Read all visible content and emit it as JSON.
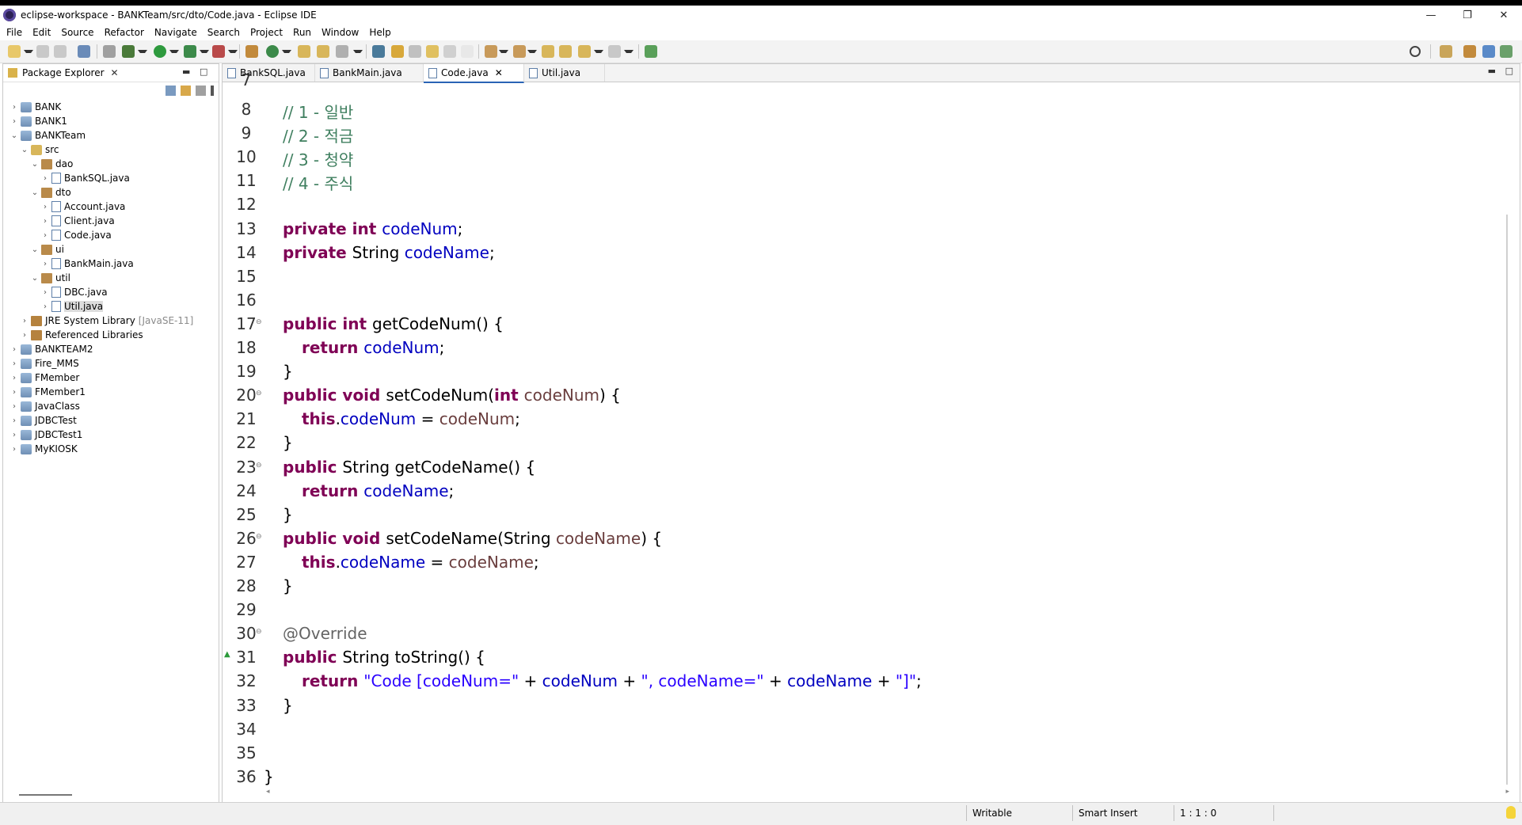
{
  "window": {
    "title": "eclipse-workspace - BANKTeam/src/dto/Code.java - Eclipse IDE",
    "minimize": "—",
    "maximize": "❐",
    "close": "✕"
  },
  "menu": [
    "File",
    "Edit",
    "Source",
    "Refactor",
    "Navigate",
    "Search",
    "Project",
    "Run",
    "Window",
    "Help"
  ],
  "explorer": {
    "title": "Package Explorer",
    "tree": [
      {
        "label": "BANK",
        "type": "proj",
        "depth": 0,
        "twisty": "›"
      },
      {
        "label": "BANK1",
        "type": "proj",
        "depth": 0,
        "twisty": "›"
      },
      {
        "label": "BANKTeam",
        "type": "proj",
        "depth": 0,
        "twisty": "⌄"
      },
      {
        "label": "src",
        "type": "src",
        "depth": 1,
        "twisty": "⌄"
      },
      {
        "label": "dao",
        "type": "pkg",
        "depth": 2,
        "twisty": "⌄"
      },
      {
        "label": "BankSQL.java",
        "type": "java",
        "depth": 3,
        "twisty": "›"
      },
      {
        "label": "dto",
        "type": "pkg",
        "depth": 2,
        "twisty": "⌄"
      },
      {
        "label": "Account.java",
        "type": "java",
        "depth": 3,
        "twisty": "›"
      },
      {
        "label": "Client.java",
        "type": "java",
        "depth": 3,
        "twisty": "›"
      },
      {
        "label": "Code.java",
        "type": "java",
        "depth": 3,
        "twisty": "›"
      },
      {
        "label": "ui",
        "type": "pkg",
        "depth": 2,
        "twisty": "⌄"
      },
      {
        "label": "BankMain.java",
        "type": "java",
        "depth": 3,
        "twisty": "›"
      },
      {
        "label": "util",
        "type": "pkg",
        "depth": 2,
        "twisty": "⌄"
      },
      {
        "label": "DBC.java",
        "type": "java",
        "depth": 3,
        "twisty": "›"
      },
      {
        "label": "Util.java",
        "type": "java",
        "depth": 3,
        "twisty": "›",
        "selected": true
      },
      {
        "label": "JRE System Library",
        "suffix": "[JavaSE-11]",
        "type": "lib",
        "depth": 1,
        "twisty": "›"
      },
      {
        "label": "Referenced Libraries",
        "type": "lib",
        "depth": 1,
        "twisty": "›"
      },
      {
        "label": "BANKTEAM2",
        "type": "proj",
        "depth": 0,
        "twisty": "›"
      },
      {
        "label": "Fire_MMS",
        "type": "proj",
        "depth": 0,
        "twisty": "›"
      },
      {
        "label": "FMember",
        "type": "proj",
        "depth": 0,
        "twisty": "›"
      },
      {
        "label": "FMember1",
        "type": "proj",
        "depth": 0,
        "twisty": "›"
      },
      {
        "label": "JavaClass",
        "type": "proj",
        "depth": 0,
        "twisty": "›"
      },
      {
        "label": "JDBCTest",
        "type": "proj",
        "depth": 0,
        "twisty": "›"
      },
      {
        "label": "JDBCTest1",
        "type": "proj",
        "depth": 0,
        "twisty": "›"
      },
      {
        "label": "MyKIOSK",
        "type": "proj",
        "depth": 0,
        "twisty": "›"
      }
    ]
  },
  "editor": {
    "tabs": [
      {
        "label": "BankSQL.java",
        "active": false
      },
      {
        "label": "BankMain.java",
        "active": false
      },
      {
        "label": "Code.java",
        "active": true
      },
      {
        "label": "Util.java",
        "active": false
      }
    ],
    "first_partial_line": "7",
    "lines": [
      {
        "n": "8",
        "tokens": [
          [
            "cm",
            "// 1 - 일반"
          ]
        ]
      },
      {
        "n": "9",
        "tokens": [
          [
            "cm",
            "// 2 - 적금"
          ]
        ]
      },
      {
        "n": "10",
        "tokens": [
          [
            "cm",
            "// 3 - 청약"
          ]
        ]
      },
      {
        "n": "11",
        "tokens": [
          [
            "cm",
            "// 4 - 주식"
          ]
        ]
      },
      {
        "n": "12",
        "tokens": []
      },
      {
        "n": "13",
        "tokens": [
          [
            "kw",
            "private int "
          ],
          [
            "fd",
            "codeNum"
          ],
          [
            "",
            "; "
          ]
        ]
      },
      {
        "n": "14",
        "tokens": [
          [
            "kw",
            "private "
          ],
          [
            "",
            "String "
          ],
          [
            "fd",
            "codeName"
          ],
          [
            "",
            ";"
          ]
        ]
      },
      {
        "n": "15",
        "tokens": []
      },
      {
        "n": "16",
        "tokens": []
      },
      {
        "n": "17",
        "fold": true,
        "tokens": [
          [
            "kw",
            "public int "
          ],
          [
            "",
            "getCodeNum() {"
          ]
        ]
      },
      {
        "n": "18",
        "indent": 1,
        "tokens": [
          [
            "kw",
            "return "
          ],
          [
            "fd",
            "codeNum"
          ],
          [
            "",
            ";"
          ]
        ]
      },
      {
        "n": "19",
        "tokens": [
          [
            "",
            "}"
          ]
        ]
      },
      {
        "n": "20",
        "fold": true,
        "tokens": [
          [
            "kw",
            "public void "
          ],
          [
            "",
            "setCodeNum("
          ],
          [
            "kw",
            "int "
          ],
          [
            "pr",
            "codeNum"
          ],
          [
            "",
            ") {"
          ]
        ]
      },
      {
        "n": "21",
        "indent": 1,
        "tokens": [
          [
            "kw",
            "this"
          ],
          [
            "",
            "."
          ],
          [
            "fd",
            "codeNum"
          ],
          [
            "",
            " = "
          ],
          [
            "pr",
            "codeNum"
          ],
          [
            "",
            ";"
          ]
        ]
      },
      {
        "n": "22",
        "tokens": [
          [
            "",
            "}"
          ]
        ]
      },
      {
        "n": "23",
        "fold": true,
        "tokens": [
          [
            "kw",
            "public "
          ],
          [
            "",
            "String getCodeName() {"
          ]
        ]
      },
      {
        "n": "24",
        "indent": 1,
        "tokens": [
          [
            "kw",
            "return "
          ],
          [
            "fd",
            "codeName"
          ],
          [
            "",
            ";"
          ]
        ]
      },
      {
        "n": "25",
        "tokens": [
          [
            "",
            "}"
          ]
        ]
      },
      {
        "n": "26",
        "fold": true,
        "tokens": [
          [
            "kw",
            "public void "
          ],
          [
            "",
            "setCodeName(String "
          ],
          [
            "pr",
            "codeName"
          ],
          [
            "",
            ") {"
          ]
        ]
      },
      {
        "n": "27",
        "indent": 1,
        "tokens": [
          [
            "kw",
            "this"
          ],
          [
            "",
            "."
          ],
          [
            "fd",
            "codeName"
          ],
          [
            "",
            " = "
          ],
          [
            "pr",
            "codeName"
          ],
          [
            "",
            ";"
          ]
        ]
      },
      {
        "n": "28",
        "tokens": [
          [
            "",
            "}"
          ]
        ]
      },
      {
        "n": "29",
        "tokens": []
      },
      {
        "n": "30",
        "fold": true,
        "tokens": [
          [
            "an",
            "@Override"
          ]
        ]
      },
      {
        "n": "31",
        "marker": true,
        "tokens": [
          [
            "kw",
            "public "
          ],
          [
            "",
            "String toString() {"
          ]
        ]
      },
      {
        "n": "32",
        "indent": 1,
        "tokens": [
          [
            "kw",
            "return "
          ],
          [
            "st",
            "\"Code [codeNum=\""
          ],
          [
            "",
            " + "
          ],
          [
            "fd",
            "codeNum"
          ],
          [
            "",
            " + "
          ],
          [
            "st",
            "\", codeName=\""
          ],
          [
            "",
            " + "
          ],
          [
            "fd",
            "codeName"
          ],
          [
            "",
            " + "
          ],
          [
            "st",
            "\"]\""
          ],
          [
            "",
            ";"
          ]
        ]
      },
      {
        "n": "33",
        "tokens": [
          [
            "",
            "}"
          ]
        ]
      },
      {
        "n": "34",
        "tokens": []
      },
      {
        "n": "35",
        "tokens": []
      },
      {
        "n": "36",
        "outdent": true,
        "tokens": [
          [
            "",
            "}"
          ]
        ]
      }
    ]
  },
  "status": {
    "mode": "Writable",
    "insert": "Smart Insert",
    "position": "1 : 1 : 0"
  },
  "colors": {
    "comment": "#3f7f5f",
    "keyword": "#7f0055",
    "field": "#0000c0",
    "param": "#6a3e3e",
    "string": "#2a00ff",
    "annotation": "#646464"
  }
}
